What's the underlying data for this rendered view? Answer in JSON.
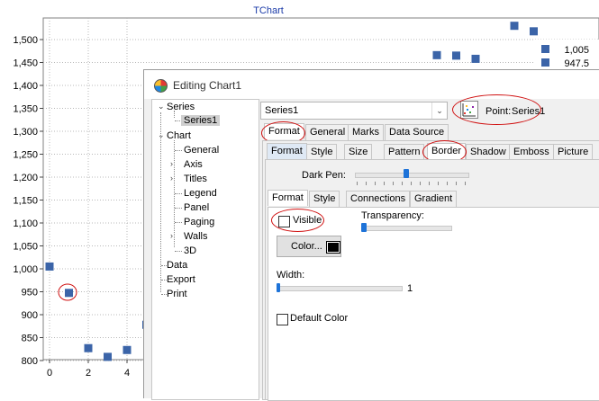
{
  "chart": {
    "title": "TChart",
    "y_ticks": [
      "1,500",
      "1,450",
      "1,400",
      "1,350",
      "1,300",
      "1,250",
      "1,200",
      "1,150",
      "1,100",
      "1,050",
      "1,000",
      "950",
      "900",
      "850",
      "800"
    ],
    "x_ticks": [
      "0",
      "2",
      "4"
    ],
    "legend": [
      {
        "value": "1,005",
        "color": "#3b64a8"
      },
      {
        "value": "947.5",
        "color": "#3b64a8"
      }
    ],
    "series_color": "#3b64a8"
  },
  "chart_data": {
    "type": "scatter",
    "title": "TChart",
    "xlabel": "",
    "ylabel": "",
    "ylim": [
      800,
      1500
    ],
    "grid": true,
    "series": [
      {
        "name": "Series1",
        "points": [
          {
            "x": 0,
            "y": 1005
          },
          {
            "x": 1,
            "y": 947.5
          },
          {
            "x": 2,
            "y": 827
          },
          {
            "x": 3,
            "y": 808
          },
          {
            "x": 4,
            "y": 823
          },
          {
            "x": 5,
            "y": 878
          },
          {
            "x": 20,
            "y": 1466
          },
          {
            "x": 21,
            "y": 1465
          },
          {
            "x": 22,
            "y": 1458
          },
          {
            "x": 24,
            "y": 1530
          },
          {
            "x": 25,
            "y": 1518
          }
        ]
      }
    ]
  },
  "dialog": {
    "title": "Editing Chart1",
    "tree": {
      "series": "Series",
      "series1": "Series1",
      "chart": "Chart",
      "general": "General",
      "axis": "Axis",
      "titles": "Titles",
      "legend": "Legend",
      "panel": "Panel",
      "paging": "Paging",
      "walls": "Walls",
      "three_d": "3D",
      "data": "Data",
      "export": "Export",
      "print": "Print"
    },
    "series_select": "Series1",
    "point_label": "Point:",
    "point_value": "Series1",
    "main_tabs": [
      "Format",
      "General",
      "Marks",
      "Data Source"
    ],
    "sub_tabs": [
      "Format",
      "Style",
      "Size",
      "Pattern",
      "Border",
      "Shadow",
      "Emboss",
      "Picture"
    ],
    "dark_pen_label": "Dark Pen:",
    "dark_pen_level": 0.45,
    "border_tabs": [
      "Format",
      "Style",
      "Connections",
      "Gradient"
    ],
    "visible_label": "Visible",
    "visible_checked": false,
    "transparency_label": "Transparency:",
    "transparency_value": 0,
    "color_button_label": "Color...",
    "width_label": "Width:",
    "width_value": "1",
    "default_color_label": "Default Color",
    "default_color_checked": false
  }
}
